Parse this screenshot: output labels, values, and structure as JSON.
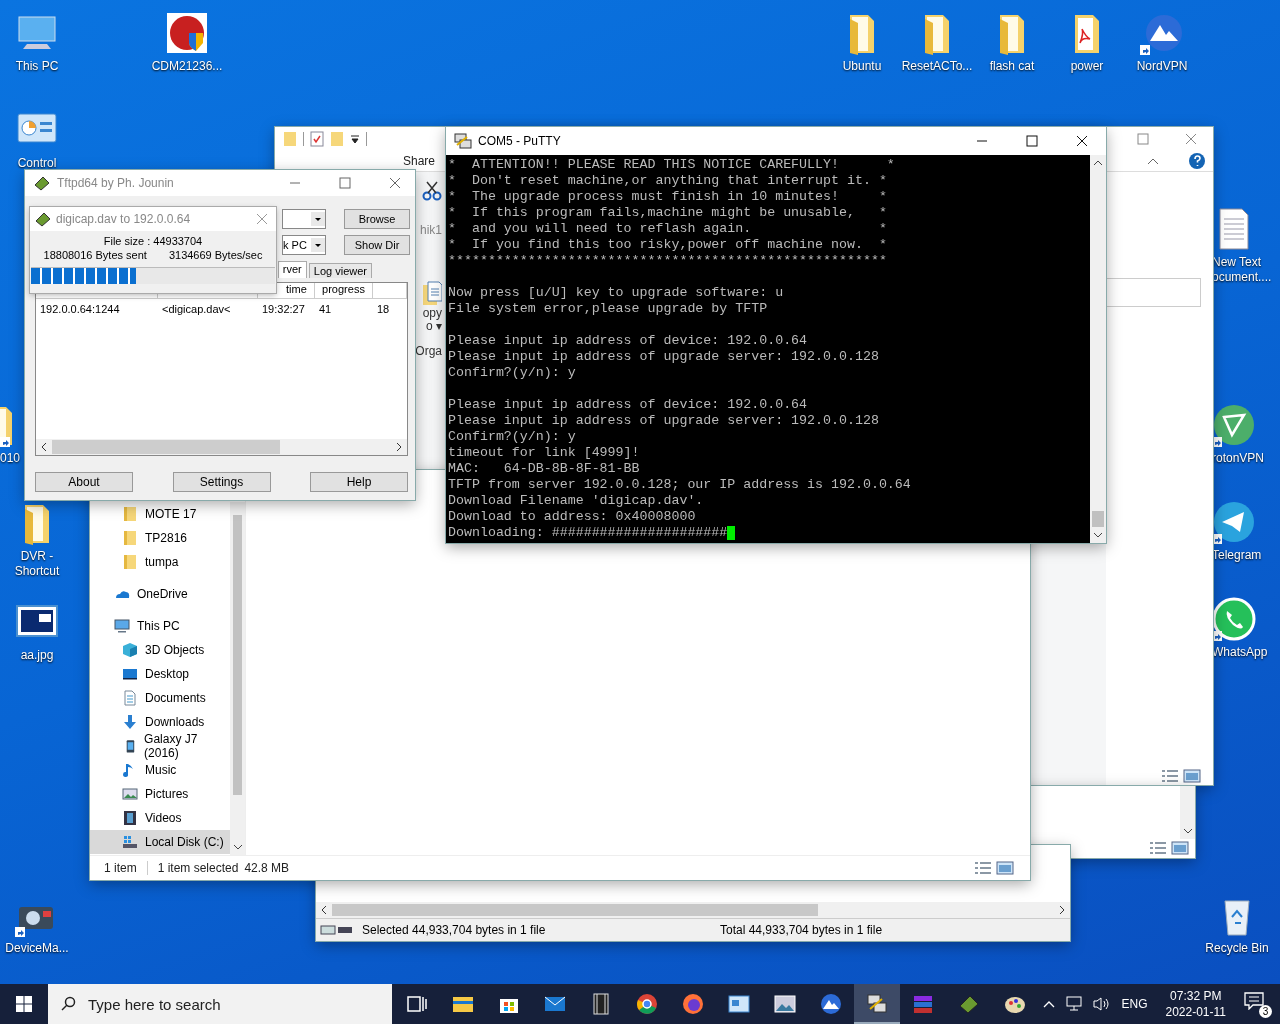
{
  "desktop_icons": [
    {
      "kind": "pc",
      "label": "This PC",
      "shortcut": false
    },
    {
      "kind": "installer",
      "label": "CDM21236...",
      "shortcut": false
    },
    {
      "kind": "folder",
      "label": "Ubuntu",
      "shortcut": false
    },
    {
      "kind": "folder",
      "label": "ResetACTo...",
      "shortcut": false
    },
    {
      "kind": "folder",
      "label": "flash cat",
      "shortcut": false
    },
    {
      "kind": "pdf",
      "label": "power",
      "shortcut": false
    },
    {
      "kind": "nordvpn",
      "label": "NordVPN",
      "shortcut": true
    },
    {
      "kind": "control",
      "label": "Control",
      "shortcut": false
    },
    {
      "kind": "folder",
      "label": "010",
      "shortcut": true
    },
    {
      "kind": "folder",
      "label": "DVR - Shortcut",
      "shortcut": false
    },
    {
      "kind": "image",
      "label": "aa.jpg",
      "shortcut": false
    },
    {
      "kind": "device",
      "label": "DeviceMa...",
      "shortcut": true
    },
    {
      "kind": "text",
      "label": "New Text ocument....",
      "shortcut": false
    },
    {
      "kind": "proton",
      "label": "rotonVPN",
      "shortcut": true
    },
    {
      "kind": "telegram",
      "label": "Telegram",
      "shortcut": true
    },
    {
      "kind": "whatsapp",
      "label": "WhatsApp",
      "shortcut": true
    },
    {
      "kind": "recycle",
      "label": "Recycle Bin",
      "shortcut": false
    }
  ],
  "explorer_back": {
    "tab": "Share",
    "ribbon_labels": [
      "hik1",
      "opy",
      "o ▾",
      "Orga"
    ]
  },
  "explorer": {
    "folders": [
      {
        "label": "MOTE 17",
        "kind": "folder",
        "selected": false
      },
      {
        "label": "TP2816",
        "kind": "folder",
        "selected": false
      },
      {
        "label": "tumpa",
        "kind": "folder",
        "selected": false
      }
    ],
    "roots": [
      {
        "label": "OneDrive",
        "kind": "onedrive",
        "selected": false
      },
      {
        "label": "This PC",
        "kind": "pc",
        "selected": false,
        "children": [
          {
            "label": "3D Objects",
            "kind": "cube",
            "selected": false
          },
          {
            "label": "Desktop",
            "kind": "desktop",
            "selected": false
          },
          {
            "label": "Documents",
            "kind": "docs",
            "selected": false
          },
          {
            "label": "Downloads",
            "kind": "download",
            "selected": false
          },
          {
            "label": "Galaxy J7 (2016)",
            "kind": "phone",
            "selected": false
          },
          {
            "label": "Music",
            "kind": "music",
            "selected": false
          },
          {
            "label": "Pictures",
            "kind": "pictures",
            "selected": false
          },
          {
            "label": "Videos",
            "kind": "videos",
            "selected": false
          },
          {
            "label": "Local Disk (C:)",
            "kind": "disk",
            "selected": true
          }
        ]
      }
    ],
    "status": {
      "count": "1 item",
      "selection": "1 item selected",
      "size": "42.8 MB"
    }
  },
  "file_window": {
    "status": [
      "Selected 44,933,704 bytes in 1 file",
      "Total 44,933,704 bytes in 1 file"
    ]
  },
  "tftpd": {
    "title": "Tftpd64 by Ph. Jounin",
    "controls": [
      {
        "button": "Browse"
      },
      {
        "button": "Show Dir",
        "dropdown": "k PC"
      }
    ],
    "tabs": [
      {
        "label": "rver",
        "selected": true
      },
      {
        "label": "Log viewer",
        "selected": false
      }
    ],
    "columns": [
      null,
      null,
      {
        "label": "time"
      },
      {
        "label": "progress"
      }
    ],
    "rows": [
      [
        "192.0.0.64:1244",
        "<digicap.dav<",
        "19:32:27",
        "41",
        "18"
      ]
    ],
    "footer_buttons": [
      "About",
      "Settings",
      "Help"
    ],
    "transfer": {
      "title": "digicap.dav to 192.0.0.64",
      "file_size": "File size : 44933704",
      "sent": "18808016 Bytes sent",
      "rate": "3134669 Bytes/sec",
      "level": 0.43
    }
  },
  "putty": {
    "title": "COM5 - PuTTY",
    "blocks": [
      [
        "*  ATTENTION!! PLEASE READ THIS NOTICE CAREFULLY!      *",
        "*  Don't reset machine,or anything that interrupt it. *",
        "*  The upgrade process must finish in 10 minutes!     *",
        "*  If this program fails,machine might be unusable,   *",
        "*  and you will need to reflash again.                *",
        "*  If you find this too risky,power off machine now.  *",
        "*******************************************************"
      ],
      [
        "Now press [u/U] key to upgrade software: u",
        "File system error,please upgrade by TFTP"
      ],
      [
        "Please input ip address of device: 192.0.0.64",
        "Please input ip address of upgrade server: 192.0.0.128",
        "Confirm?(y/n): y"
      ],
      [
        "Please input ip address of device: 192.0.0.64",
        "Please input ip address of upgrade server: 192.0.0.128",
        "Confirm?(y/n): y",
        "timeout for link [4999]!",
        "MAC:   64-DB-8B-8F-81-BB",
        "TFTP from server 192.0.0.128; our IP address is 192.0.0.64",
        "Download Filename 'digicap.dav'.",
        "Download to address: 0x40008000",
        "Downloading: ######################"
      ]
    ]
  },
  "taskbar": {
    "search_placeholder": "Type here to search",
    "apps": [
      {
        "kind": "taskview",
        "active": false
      },
      {
        "kind": "explorer",
        "active": false
      },
      {
        "kind": "store",
        "active": false
      },
      {
        "kind": "mail",
        "active": false
      },
      {
        "kind": "film",
        "active": false
      },
      {
        "kind": "chrome",
        "active": false
      },
      {
        "kind": "firefox",
        "active": false
      },
      {
        "kind": "panel",
        "active": false
      },
      {
        "kind": "photos",
        "active": false
      },
      {
        "kind": "nordvpn",
        "active": false
      },
      {
        "kind": "putty",
        "active": true
      },
      {
        "kind": "winrar",
        "active": false
      },
      {
        "kind": "tftpd",
        "active": false
      },
      {
        "kind": "paint",
        "active": false
      }
    ],
    "language": "ENG",
    "time": "07:32 PM",
    "date": "2022-01-11",
    "notifications": "3"
  }
}
